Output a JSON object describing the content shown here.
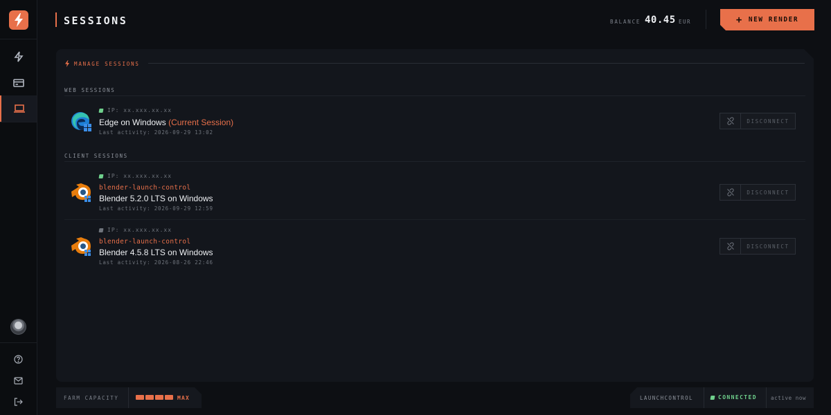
{
  "header": {
    "title": "SESSIONS",
    "balance_label": "BALANCE",
    "balance_value": "40.45",
    "balance_currency": "EUR",
    "new_render_label": "NEW RENDER",
    "new_render_icon": "+"
  },
  "sidebar": {
    "logo_icon": "bolt-logo-icon",
    "items": [
      {
        "name": "bolt-icon",
        "active": false
      },
      {
        "name": "credit-card-icon",
        "active": false
      },
      {
        "name": "laptop-icon",
        "active": true
      }
    ],
    "footer_items": [
      "help-icon",
      "mail-icon",
      "logout-icon"
    ]
  },
  "panel": {
    "title": "MANAGE SESSIONS",
    "web_label": "WEB SESSIONS",
    "client_label": "CLIENT SESSIONS"
  },
  "web_sessions": [
    {
      "icon": "edge-icon",
      "ip": "IP: xx.xxx.xx.xx",
      "status": "online",
      "device": "Edge on Windows",
      "current": "(Current Session)",
      "activity": "Last activity: 2026-09-29 13:02",
      "action": "DISCONNECT"
    }
  ],
  "client_sessions": [
    {
      "icon": "blender-icon",
      "ip": "IP: xx.xxx.xx.xx",
      "status": "online",
      "client": "blender-launch-control",
      "device": "Blender 5.2.0 LTS on Windows",
      "activity": "Last activity: 2026-09-29 12:59",
      "action": "DISCONNECT"
    },
    {
      "icon": "blender-icon",
      "ip": "IP: xx.xxx.xx.xx",
      "status": "offline",
      "client": "blender-launch-control",
      "device": "Blender 4.5.8 LTS on Windows",
      "activity": "Last activity: 2026-08-26 22:46",
      "action": "DISCONNECT"
    }
  ],
  "footer": {
    "farm_capacity_label": "FARM CAPACITY",
    "farm_capacity_value": "MAX",
    "farm_capacity_bars": 4,
    "launchcontrol_label": "LAUNCHCONTROL",
    "connection_status": "CONNECTED",
    "active_text": "active now"
  },
  "colors": {
    "accent": "#e8704a",
    "online": "#6fd08c",
    "background": "#0d0f13",
    "panel": "#13161c"
  }
}
